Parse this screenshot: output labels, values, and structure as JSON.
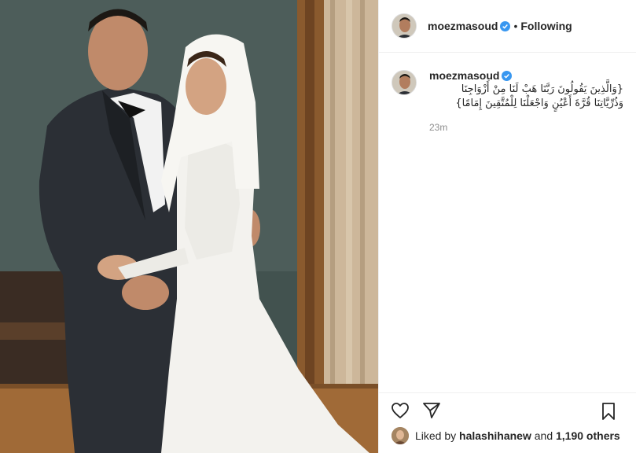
{
  "header": {
    "username": "moezmasoud",
    "separator": "•",
    "follow_label": "Following"
  },
  "caption": {
    "username": "moezmasoud",
    "text": "{وَالَّذِينَ يَقُولُونَ رَبَّنَا هَبْ لَنَا مِنْ أَزْوَاجِنَا وَذُرِّيَّاتِنَا قُرَّةَ أَعْيُنٍ وَاجْعَلْنَا لِلْمُتَّقِينَ إِمَامًا}",
    "time": "23m"
  },
  "likes": {
    "prefix": "Liked by",
    "user": "halashihanew",
    "middle": "and",
    "others": "1,190 others"
  },
  "colors": {
    "verified": "#3897f0",
    "text": "#262626",
    "muted": "#8e8e8e",
    "border": "#efefef"
  },
  "icons": [
    "verified-badge-icon",
    "heart-icon",
    "share-icon",
    "bookmark-icon"
  ]
}
